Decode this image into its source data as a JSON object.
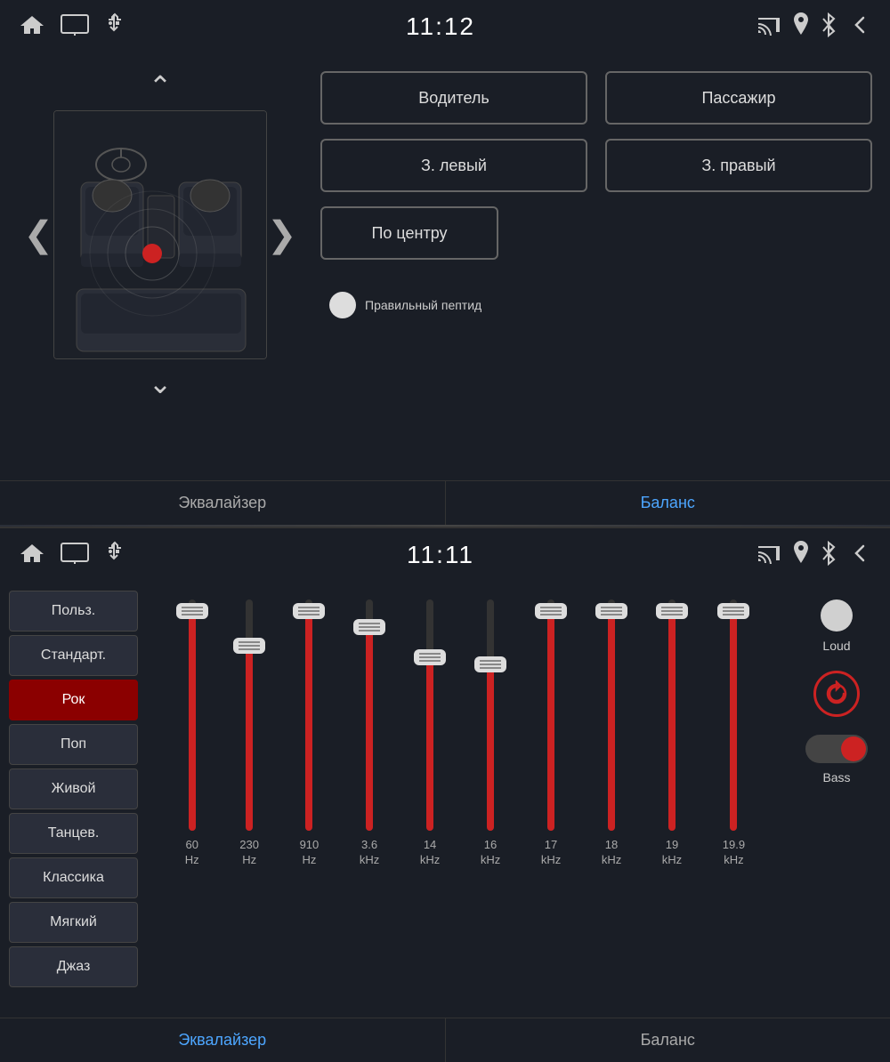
{
  "topPanel": {
    "statusBar": {
      "time": "11:12",
      "leftIcons": [
        "home-icon",
        "screen-icon",
        "usb-icon"
      ],
      "rightIcons": [
        "cast-icon",
        "location-icon",
        "bluetooth-icon",
        "back-icon"
      ]
    },
    "seatButtons": [
      {
        "id": "driver",
        "label": "Водитель"
      },
      {
        "id": "passenger",
        "label": "Пассажир"
      },
      {
        "id": "rear-left",
        "label": "З. левый"
      },
      {
        "id": "rear-right",
        "label": "З. правый"
      },
      {
        "id": "center",
        "label": "По центру"
      }
    ],
    "indicatorText": "Правильный пептид",
    "tabs": [
      {
        "id": "eq",
        "label": "Эквалайзер",
        "active": false
      },
      {
        "id": "balance",
        "label": "Баланс",
        "active": true
      }
    ]
  },
  "bottomPanel": {
    "statusBar": {
      "time": "11:11",
      "leftIcons": [
        "home-icon",
        "screen-icon",
        "usb-icon"
      ],
      "rightIcons": [
        "cast-icon",
        "location-icon",
        "bluetooth-icon",
        "back-icon"
      ]
    },
    "presets": [
      {
        "id": "user",
        "label": "Польз.",
        "active": false
      },
      {
        "id": "standard",
        "label": "Стандарт.",
        "active": false
      },
      {
        "id": "rock",
        "label": "Рок",
        "active": true
      },
      {
        "id": "pop",
        "label": "Поп",
        "active": false
      },
      {
        "id": "live",
        "label": "Живой",
        "active": false
      },
      {
        "id": "dance",
        "label": "Танцев.",
        "active": false
      },
      {
        "id": "classic",
        "label": "Классика",
        "active": false
      },
      {
        "id": "soft",
        "label": "Мягкий",
        "active": false
      },
      {
        "id": "jazz",
        "label": "Джаз",
        "active": false
      }
    ],
    "sliders": [
      {
        "freq": "60",
        "unit": "Hz",
        "fillPercent": 95,
        "thumbPercent": 5
      },
      {
        "freq": "230",
        "unit": "Hz",
        "fillPercent": 80,
        "thumbPercent": 20
      },
      {
        "freq": "910",
        "unit": "Hz",
        "fillPercent": 95,
        "thumbPercent": 5
      },
      {
        "freq": "3.6",
        "unit": "kHz",
        "fillPercent": 88,
        "thumbPercent": 12
      },
      {
        "freq": "14",
        "unit": "kHz",
        "fillPercent": 75,
        "thumbPercent": 25
      },
      {
        "freq": "16",
        "unit": "kHz",
        "fillPercent": 72,
        "thumbPercent": 28
      },
      {
        "freq": "17",
        "unit": "kHz",
        "fillPercent": 95,
        "thumbPercent": 5
      },
      {
        "freq": "18",
        "unit": "kHz",
        "fillPercent": 95,
        "thumbPercent": 5
      },
      {
        "freq": "19",
        "unit": "kHz",
        "fillPercent": 95,
        "thumbPercent": 5
      },
      {
        "freq": "19.9",
        "unit": "kHz",
        "fillPercent": 95,
        "thumbPercent": 5
      }
    ],
    "loudLabel": "Loud",
    "bassLabel": "Bass",
    "tabs": [
      {
        "id": "eq",
        "label": "Эквалайзер",
        "active": true
      },
      {
        "id": "balance",
        "label": "Баланс",
        "active": false
      }
    ]
  }
}
